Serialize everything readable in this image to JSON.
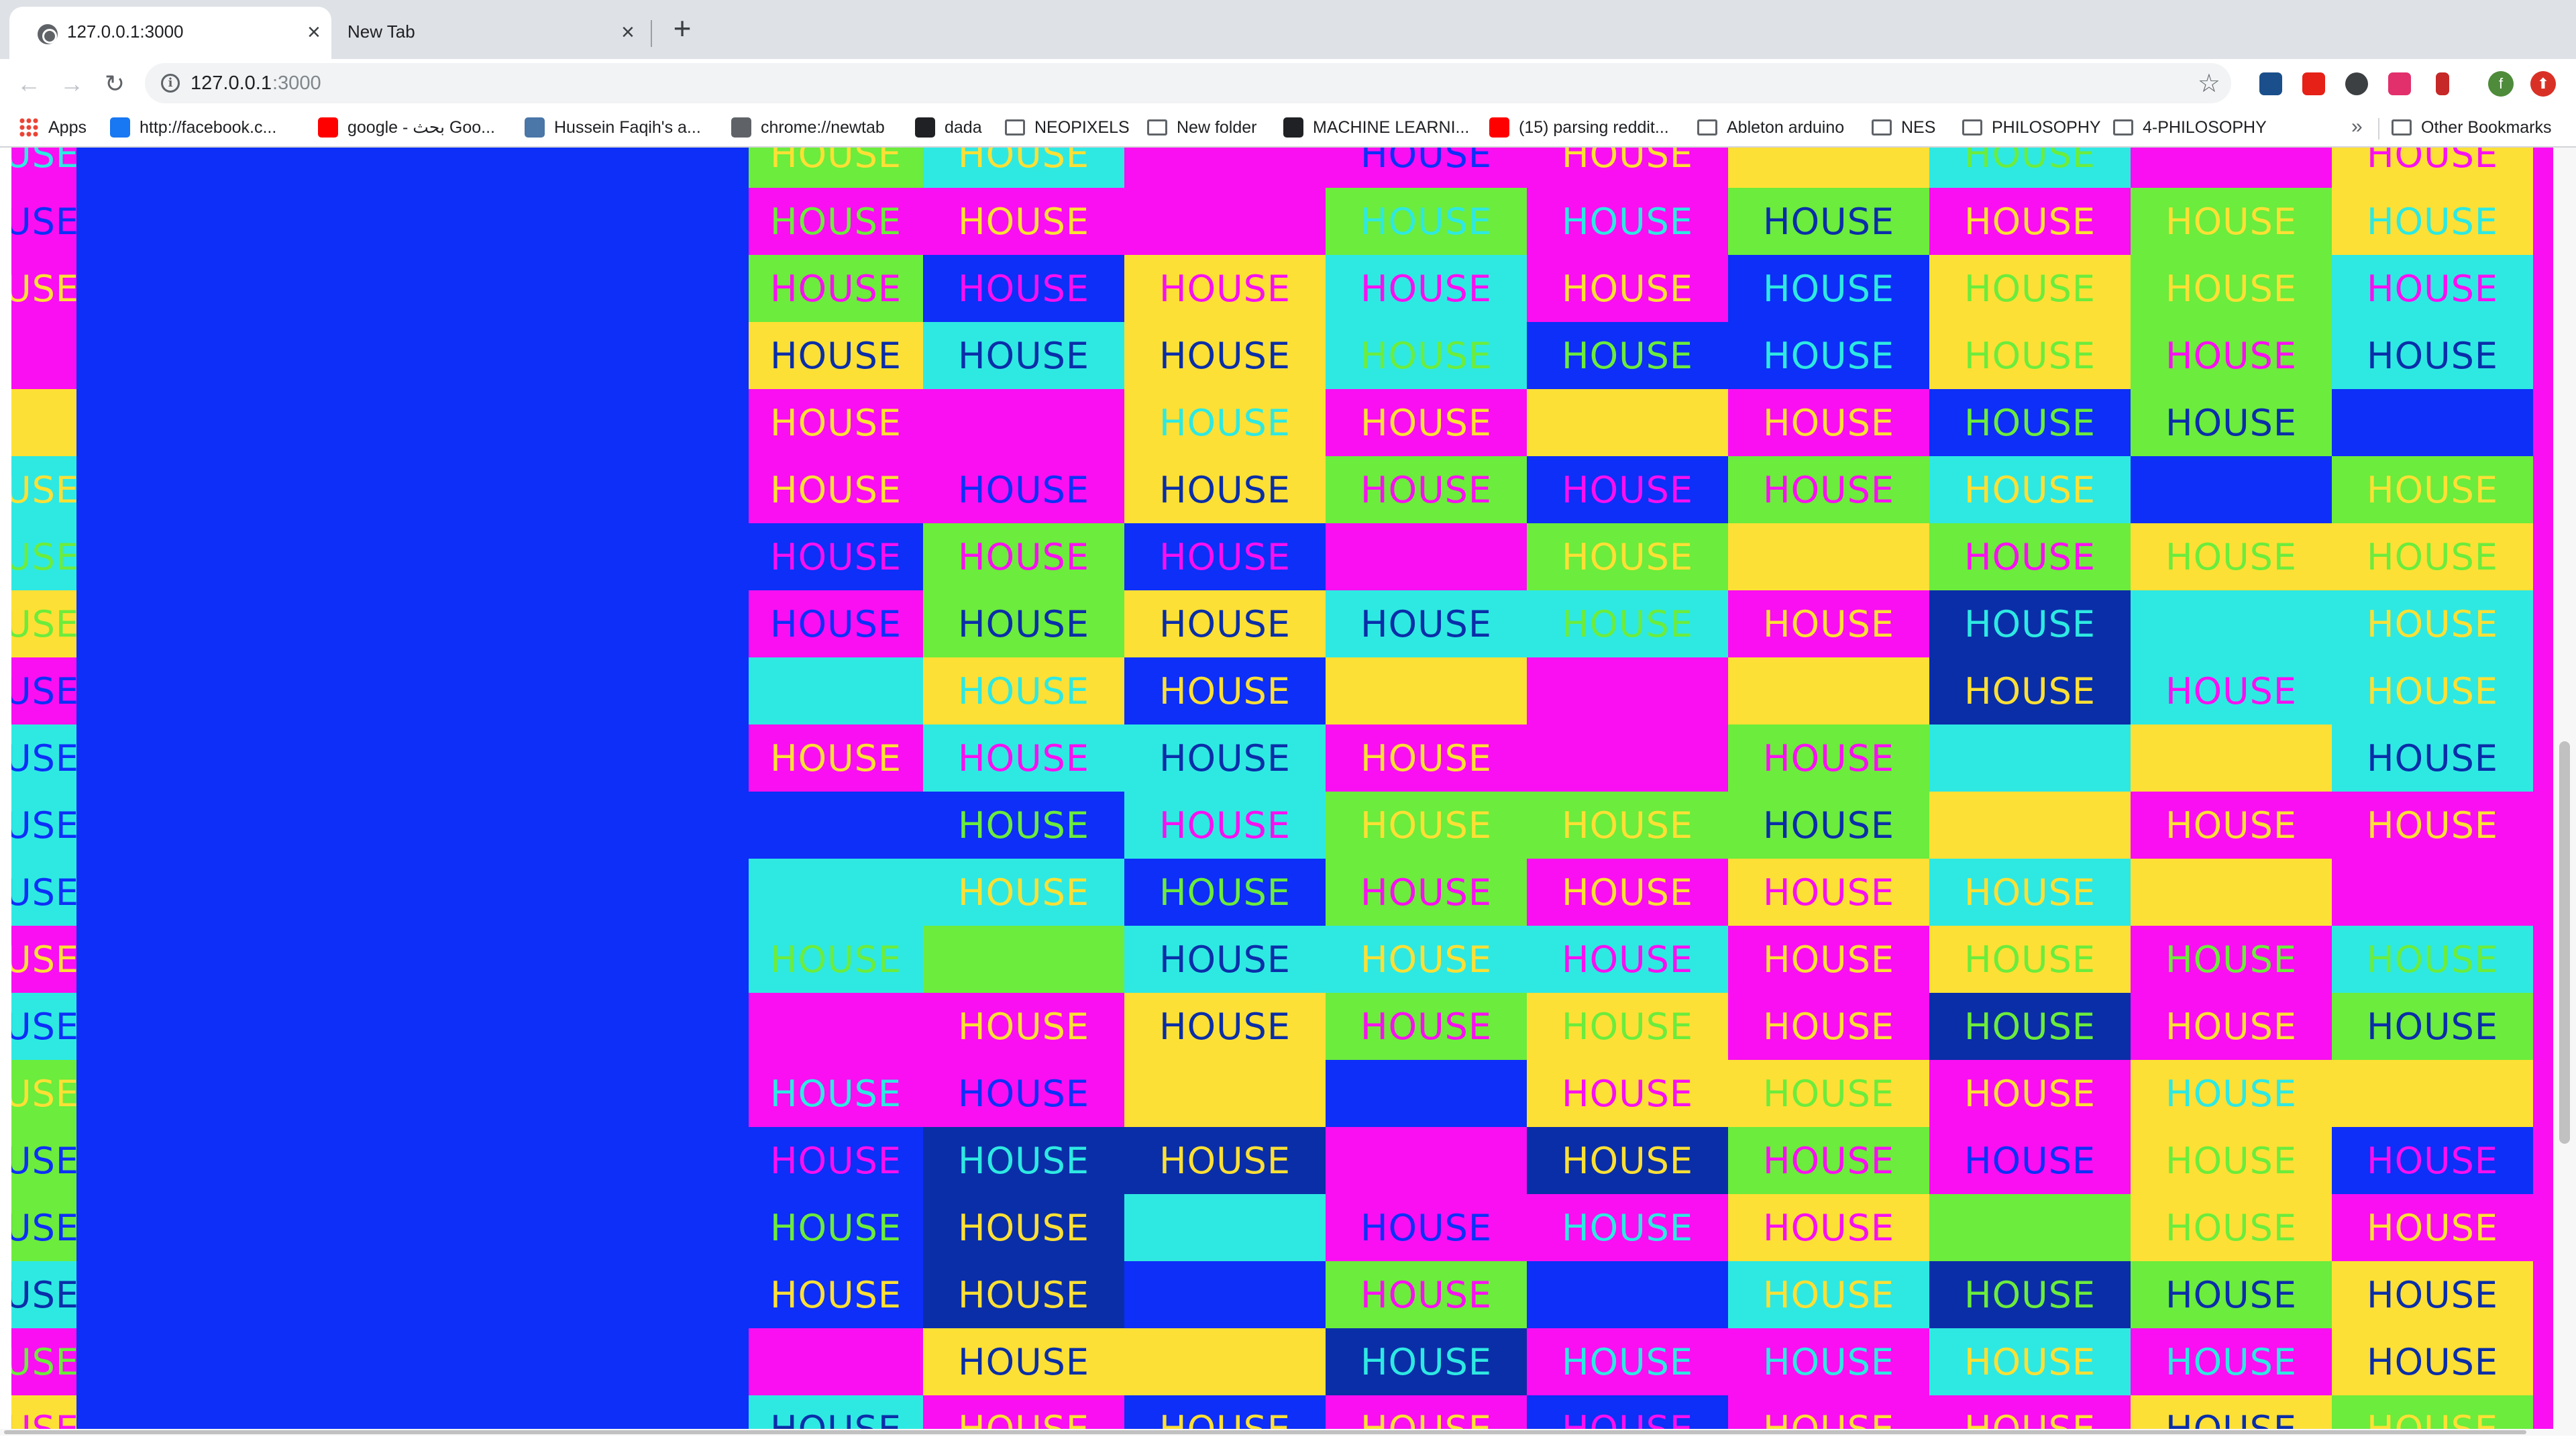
{
  "browser": {
    "tabs": [
      {
        "title": "127.0.0.1:3000",
        "close": "×"
      },
      {
        "title": "New Tab",
        "close": "×"
      }
    ],
    "new_tab": "+",
    "nav": {
      "back": "←",
      "forward": "→",
      "reload": "↻"
    },
    "url": {
      "host": "127.0.0.1",
      "port": ":3000"
    },
    "info_icon": "i",
    "star": "☆",
    "profile_letter": "f",
    "bookmarks": [
      {
        "label": "Apps",
        "icon": "apps-grid-icon",
        "color": "#ea4335"
      },
      {
        "label": "http://facebook.c...",
        "icon": "facebook-icon",
        "color": "#1877f2"
      },
      {
        "label": "google - بحث Goo...",
        "icon": "youtube-icon",
        "color": "#ff0000"
      },
      {
        "label": "Hussein Faqih's a...",
        "icon": "vk-icon",
        "color": "#4a76a8"
      },
      {
        "label": "chrome://newtab",
        "icon": "globe-icon",
        "color": "#5f6368"
      },
      {
        "label": "dada",
        "icon": "wikipedia-icon",
        "color": "#202124"
      },
      {
        "label": "NEOPIXELS",
        "icon": "folder-icon",
        "color": "#5f6368"
      },
      {
        "label": "New folder",
        "icon": "folder-icon",
        "color": "#5f6368"
      },
      {
        "label": "MACHINE LEARNI...",
        "icon": "github-icon",
        "color": "#202124"
      },
      {
        "label": "(15) parsing reddit...",
        "icon": "youtube-icon",
        "color": "#ff0000"
      },
      {
        "label": "Ableton arduino",
        "icon": "folder-icon",
        "color": "#5f6368"
      },
      {
        "label": "NES",
        "icon": "folder-icon",
        "color": "#5f6368"
      },
      {
        "label": "PHILOSOPHY",
        "icon": "folder-icon",
        "color": "#5f6368"
      },
      {
        "label": "4-PHILOSOPHY",
        "icon": "folder-icon",
        "color": "#5f6368"
      }
    ],
    "bookmarks_more": "»",
    "other_bookmarks": "Other Bookmarks"
  },
  "page": {
    "word": "HOUSE",
    "palette": {
      "m": "#f90ff1",
      "y": "#fde035",
      "c": "#2ee9e2",
      "g": "#6cec3c",
      "b": "#0d2ff7",
      "n": "#0a2ea8"
    },
    "left_column": [
      [
        "m",
        "c"
      ],
      [
        "m",
        "b"
      ],
      [
        "m",
        "y"
      ],
      [
        "m",
        null
      ],
      [
        "y",
        null
      ],
      [
        "c",
        "y"
      ],
      [
        "c",
        "g"
      ],
      [
        "y",
        "g"
      ],
      [
        "m",
        "b"
      ],
      [
        "c",
        "b"
      ],
      [
        "c",
        "b"
      ],
      [
        "c",
        "b"
      ],
      [
        "m",
        "y"
      ],
      [
        "c",
        "b"
      ],
      [
        "g",
        "y"
      ],
      [
        "g",
        "b"
      ],
      [
        "g",
        "b"
      ],
      [
        "c",
        "n"
      ],
      [
        "m",
        "g"
      ],
      [
        "y",
        "m"
      ]
    ],
    "columns": [
      [
        [
          "g",
          "y"
        ],
        [
          "m",
          "g"
        ],
        [
          "g",
          "m"
        ],
        [
          "y",
          "n"
        ],
        [
          "m",
          "y"
        ],
        [
          "m",
          "y"
        ],
        [
          "b",
          "m"
        ],
        [
          "m",
          "b"
        ],
        [
          "c",
          null
        ],
        [
          "m",
          "y"
        ],
        [
          "b",
          null
        ],
        [
          "c",
          null
        ],
        [
          "c",
          "g"
        ],
        [
          "m",
          null
        ],
        [
          "m",
          "c"
        ],
        [
          "b",
          "m"
        ],
        [
          "b",
          "g"
        ],
        [
          "b",
          "y"
        ],
        [
          "m",
          null
        ],
        [
          "c",
          "n"
        ]
      ],
      [
        [
          "c",
          "y"
        ],
        [
          "m",
          "y"
        ],
        [
          "b",
          "m"
        ],
        [
          "c",
          "n"
        ],
        [
          "m",
          null
        ],
        [
          "m",
          "b"
        ],
        [
          "g",
          "m"
        ],
        [
          "g",
          "n"
        ],
        [
          "y",
          "c"
        ],
        [
          "c",
          "m"
        ],
        [
          "b",
          "g"
        ],
        [
          "c",
          "y"
        ],
        [
          "g",
          null
        ],
        [
          "m",
          "y"
        ],
        [
          "m",
          "b"
        ],
        [
          "n",
          "c"
        ],
        [
          "n",
          "y"
        ],
        [
          "n",
          "y"
        ],
        [
          "y",
          "n"
        ],
        [
          "m",
          "y"
        ]
      ],
      [
        [
          "m",
          null
        ],
        [
          "m",
          null
        ],
        [
          "y",
          "m"
        ],
        [
          "y",
          "n"
        ],
        [
          "y",
          "c"
        ],
        [
          "y",
          "n"
        ],
        [
          "b",
          "m"
        ],
        [
          "y",
          "n"
        ],
        [
          "b",
          "y"
        ],
        [
          "c",
          "n"
        ],
        [
          "c",
          "m"
        ],
        [
          "b",
          "g"
        ],
        [
          "c",
          "n"
        ],
        [
          "y",
          "n"
        ],
        [
          "y",
          null
        ],
        [
          "n",
          "y"
        ],
        [
          "c",
          null
        ],
        [
          "b",
          null
        ],
        [
          "y",
          null
        ],
        [
          "b",
          "y"
        ]
      ],
      [
        [
          "m",
          "b"
        ],
        [
          "g",
          "c"
        ],
        [
          "c",
          "m"
        ],
        [
          "c",
          "g"
        ],
        [
          "m",
          "y"
        ],
        [
          "g",
          "m"
        ],
        [
          "m",
          null
        ],
        [
          "c",
          "n"
        ],
        [
          "y",
          null
        ],
        [
          "m",
          "y"
        ],
        [
          "g",
          "y"
        ],
        [
          "g",
          "m"
        ],
        [
          "c",
          "y"
        ],
        [
          "g",
          "m"
        ],
        [
          "b",
          null
        ],
        [
          "m",
          null
        ],
        [
          "m",
          "b"
        ],
        [
          "g",
          "m"
        ],
        [
          "n",
          "c"
        ],
        [
          "m",
          "y"
        ]
      ],
      [
        [
          "m",
          "y"
        ],
        [
          "m",
          "c"
        ],
        [
          "m",
          "y"
        ],
        [
          "b",
          "g"
        ],
        [
          "y",
          null
        ],
        [
          "b",
          "m"
        ],
        [
          "g",
          "y"
        ],
        [
          "c",
          "g"
        ],
        [
          "m",
          null
        ],
        [
          "m",
          null
        ],
        [
          "g",
          "y"
        ],
        [
          "m",
          "y"
        ],
        [
          "c",
          "m"
        ],
        [
          "y",
          "g"
        ],
        [
          "y",
          "m"
        ],
        [
          "n",
          "y"
        ],
        [
          "m",
          "c"
        ],
        [
          "b",
          null
        ],
        [
          "m",
          "c"
        ],
        [
          "b",
          "m"
        ]
      ],
      [
        [
          "y",
          null
        ],
        [
          "g",
          "n"
        ],
        [
          "b",
          "c"
        ],
        [
          "b",
          "c"
        ],
        [
          "m",
          "y"
        ],
        [
          "g",
          "m"
        ],
        [
          "y",
          null
        ],
        [
          "m",
          "y"
        ],
        [
          "y",
          null
        ],
        [
          "g",
          "m"
        ],
        [
          "g",
          "n"
        ],
        [
          "y",
          "m"
        ],
        [
          "m",
          "y"
        ],
        [
          "m",
          "y"
        ],
        [
          "y",
          "g"
        ],
        [
          "g",
          "m"
        ],
        [
          "y",
          "m"
        ],
        [
          "c",
          "y"
        ],
        [
          "m",
          "c"
        ],
        [
          "m",
          "y"
        ]
      ],
      [
        [
          "c",
          "g"
        ],
        [
          "m",
          "y"
        ],
        [
          "y",
          "g"
        ],
        [
          "y",
          "g"
        ],
        [
          "b",
          "g"
        ],
        [
          "c",
          "y"
        ],
        [
          "g",
          "m"
        ],
        [
          "n",
          "c"
        ],
        [
          "n",
          "y"
        ],
        [
          "c",
          null
        ],
        [
          "y",
          null
        ],
        [
          "c",
          "y"
        ],
        [
          "y",
          "g"
        ],
        [
          "n",
          "g"
        ],
        [
          "m",
          "y"
        ],
        [
          "m",
          "b"
        ],
        [
          "g",
          null
        ],
        [
          "n",
          "g"
        ],
        [
          "c",
          "y"
        ],
        [
          "m",
          "y"
        ]
      ],
      [
        [
          "m",
          null
        ],
        [
          "g",
          "y"
        ],
        [
          "g",
          "y"
        ],
        [
          "g",
          "m"
        ],
        [
          "g",
          "n"
        ],
        [
          "b",
          null
        ],
        [
          "y",
          "g"
        ],
        [
          "c",
          null
        ],
        [
          "c",
          "m"
        ],
        [
          "y",
          null
        ],
        [
          "m",
          "y"
        ],
        [
          "y",
          null
        ],
        [
          "m",
          "g"
        ],
        [
          "m",
          "y"
        ],
        [
          "y",
          "c"
        ],
        [
          "y",
          "g"
        ],
        [
          "y",
          "g"
        ],
        [
          "g",
          "n"
        ],
        [
          "m",
          "c"
        ],
        [
          "y",
          "n"
        ]
      ],
      [
        [
          "y",
          "m"
        ],
        [
          "y",
          "c"
        ],
        [
          "c",
          "m"
        ],
        [
          "c",
          "n"
        ],
        [
          "b",
          null
        ],
        [
          "g",
          "y"
        ],
        [
          "y",
          "g"
        ],
        [
          "c",
          "y"
        ],
        [
          "c",
          "y"
        ],
        [
          "c",
          "n"
        ],
        [
          "m",
          "y"
        ],
        [
          "m",
          null
        ],
        [
          "c",
          "g"
        ],
        [
          "g",
          "n"
        ],
        [
          "y",
          null
        ],
        [
          "b",
          "m"
        ],
        [
          "m",
          "y"
        ],
        [
          "y",
          "n"
        ],
        [
          "y",
          "n"
        ],
        [
          "g",
          "y"
        ]
      ]
    ]
  }
}
